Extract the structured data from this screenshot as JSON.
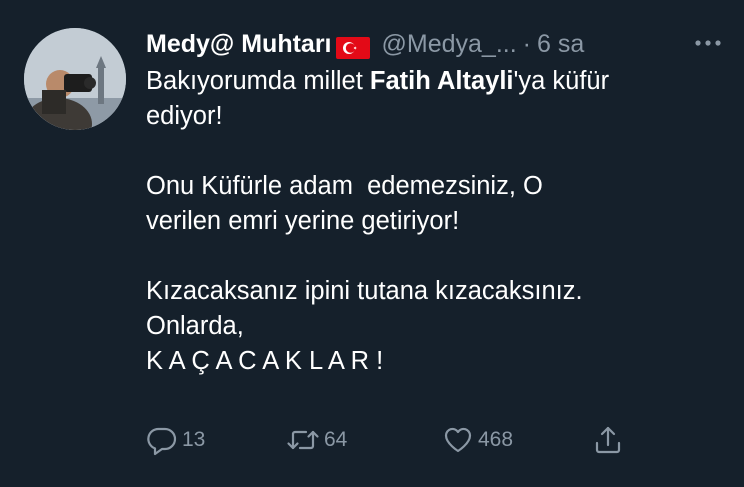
{
  "tweet": {
    "display_name": "Medy@ Muhtarı",
    "handle": "@Medya_...",
    "separator": "·",
    "time": "6 sa",
    "body": {
      "l1_pre": "Bakıyorumda millet ",
      "l1_bold": "Fatih Altayli",
      "l1_post": "'ya küfür",
      "l2": "ediyor!",
      "l3": "Onu Küfürle adam  edemezsiniz, O",
      "l4": "verilen emri yerine getiriyor!",
      "l5": "Kızacaksanız ipini tutana kızacaksınız.",
      "l6": "Onlarda,",
      "l7": "K A Ç A C A K L A R !"
    },
    "actions": {
      "reply_count": "13",
      "retweet_count": "64",
      "like_count": "468"
    }
  },
  "icons": {
    "flag": "turkey-flag-icon",
    "more": "more-dots-icon",
    "reply": "reply-icon",
    "retweet": "retweet-icon",
    "like": "heart-icon",
    "share": "share-icon"
  },
  "colors": {
    "background": "#15202b",
    "text": "#ffffff",
    "secondary": "#8b98a5",
    "flag_red": "#e30a17"
  }
}
